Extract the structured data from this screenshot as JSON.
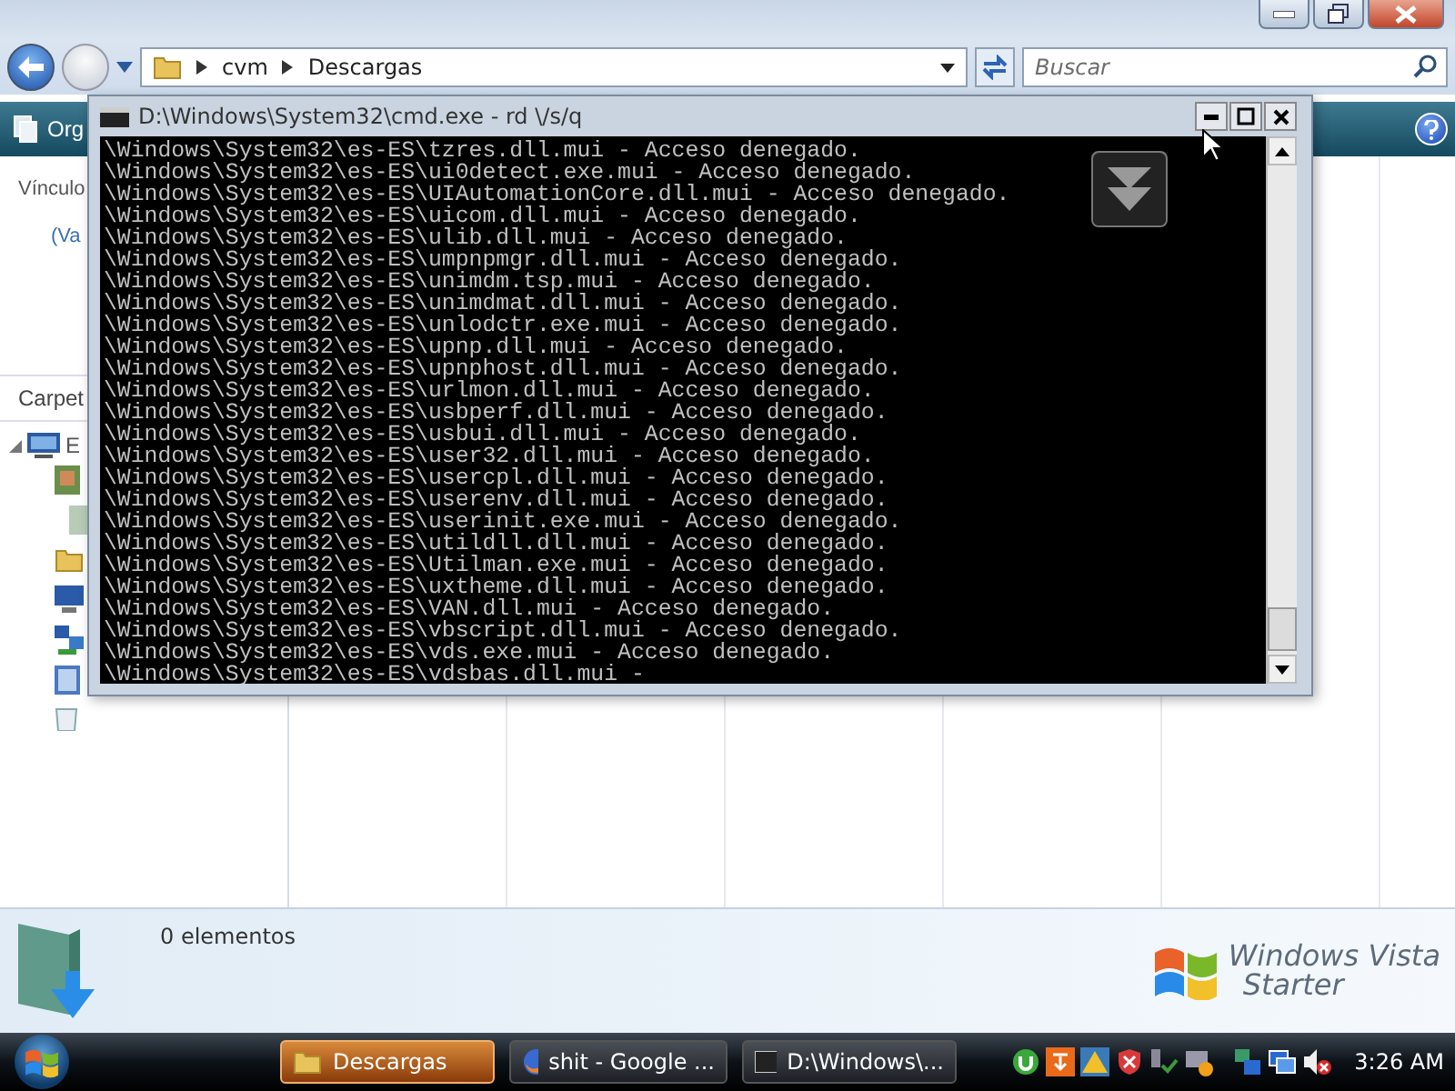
{
  "explorer": {
    "address": {
      "crumbs": [
        "cvm",
        "Descargas"
      ]
    },
    "search": {
      "placeholder": "Buscar"
    },
    "toolbar": {
      "items": [
        "Org"
      ]
    },
    "nav_pane": {
      "links_heading": "Vínculo",
      "link": "(Va",
      "folders_heading": "Carpet",
      "tree": [
        {
          "label": "E",
          "expanded": true
        }
      ]
    },
    "details": {
      "count": "0 elementos"
    },
    "branding": {
      "line1": "Windows Vista",
      "line2": "Starter"
    }
  },
  "cmd": {
    "title": "D:\\Windows\\System32\\cmd.exe - rd \\/s/q",
    "lines": [
      "\\Windows\\System32\\es-ES\\tzres.dll.mui - Acceso denegado.",
      "\\Windows\\System32\\es-ES\\ui0detect.exe.mui - Acceso denegado.",
      "\\Windows\\System32\\es-ES\\UIAutomationCore.dll.mui - Acceso denegado.",
      "\\Windows\\System32\\es-ES\\uicom.dll.mui - Acceso denegado.",
      "\\Windows\\System32\\es-ES\\ulib.dll.mui - Acceso denegado.",
      "\\Windows\\System32\\es-ES\\umpnpmgr.dll.mui - Acceso denegado.",
      "\\Windows\\System32\\es-ES\\unimdm.tsp.mui - Acceso denegado.",
      "\\Windows\\System32\\es-ES\\unimdmat.dll.mui - Acceso denegado.",
      "\\Windows\\System32\\es-ES\\unlodctr.exe.mui - Acceso denegado.",
      "\\Windows\\System32\\es-ES\\upnp.dll.mui - Acceso denegado.",
      "\\Windows\\System32\\es-ES\\upnphost.dll.mui - Acceso denegado.",
      "\\Windows\\System32\\es-ES\\urlmon.dll.mui - Acceso denegado.",
      "\\Windows\\System32\\es-ES\\usbperf.dll.mui - Acceso denegado.",
      "\\Windows\\System32\\es-ES\\usbui.dll.mui - Acceso denegado.",
      "\\Windows\\System32\\es-ES\\user32.dll.mui - Acceso denegado.",
      "\\Windows\\System32\\es-ES\\usercpl.dll.mui - Acceso denegado.",
      "\\Windows\\System32\\es-ES\\userenv.dll.mui - Acceso denegado.",
      "\\Windows\\System32\\es-ES\\userinit.exe.mui - Acceso denegado.",
      "\\Windows\\System32\\es-ES\\utildll.dll.mui - Acceso denegado.",
      "\\Windows\\System32\\es-ES\\Utilman.exe.mui - Acceso denegado.",
      "\\Windows\\System32\\es-ES\\uxtheme.dll.mui - Acceso denegado.",
      "\\Windows\\System32\\es-ES\\VAN.dll.mui - Acceso denegado.",
      "\\Windows\\System32\\es-ES\\vbscript.dll.mui - Acceso denegado.",
      "\\Windows\\System32\\es-ES\\vds.exe.mui - Acceso denegado.",
      "\\Windows\\System32\\es-ES\\vdsbas.dll.mui -"
    ]
  },
  "taskbar": {
    "buttons": [
      {
        "kind": "folder",
        "label": "Descargas",
        "selected": true
      },
      {
        "kind": "browser",
        "label": "shit - Google ...",
        "selected": false
      },
      {
        "kind": "console",
        "label": "D:\\Windows\\...",
        "selected": false
      }
    ],
    "clock": "3:26 AM"
  }
}
